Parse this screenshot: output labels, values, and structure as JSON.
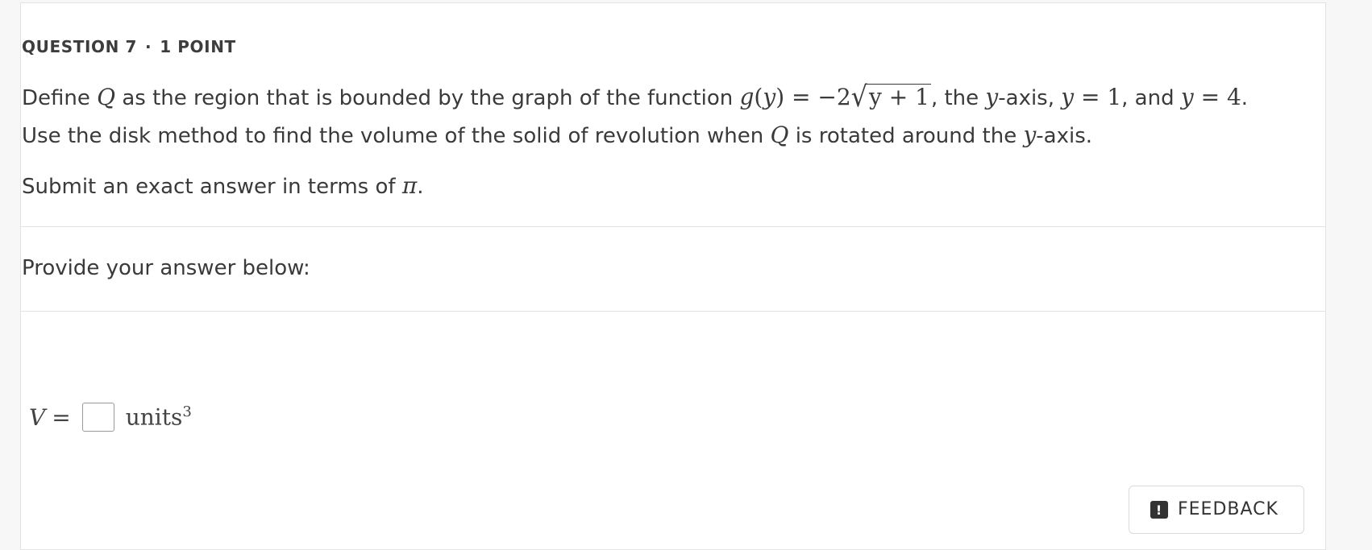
{
  "question": {
    "number_label": "QUESTION 7",
    "separator": "·",
    "points_label": "1 POINT",
    "text": {
      "t1": "Define ",
      "Q": "Q",
      "t2": " as the region that is bounded by the graph of the function ",
      "g_lhs": "g(y) = −2",
      "sqrt_arg": "y + 1",
      "t3": ", the ",
      "y1": "y",
      "t4": "-axis, ",
      "eq_y1": "y = 1",
      "t5": ", and ",
      "eq_y4": "y = 4",
      "t6": ". Use the disk method to find the volume of the solid of revolution when ",
      "Q2": "Q",
      "t7": " is rotated around the ",
      "y2": "y",
      "t8": "-axis."
    },
    "submit_text": "Submit an exact answer in terms of ",
    "pi": "π",
    "submit_end": "."
  },
  "answer_section": {
    "prompt": "Provide your answer below:",
    "variable": "V",
    "equals": "=",
    "input_value": "",
    "units": "units",
    "units_exp": "3"
  },
  "feedback": {
    "icon": "!",
    "label": "FEEDBACK"
  }
}
